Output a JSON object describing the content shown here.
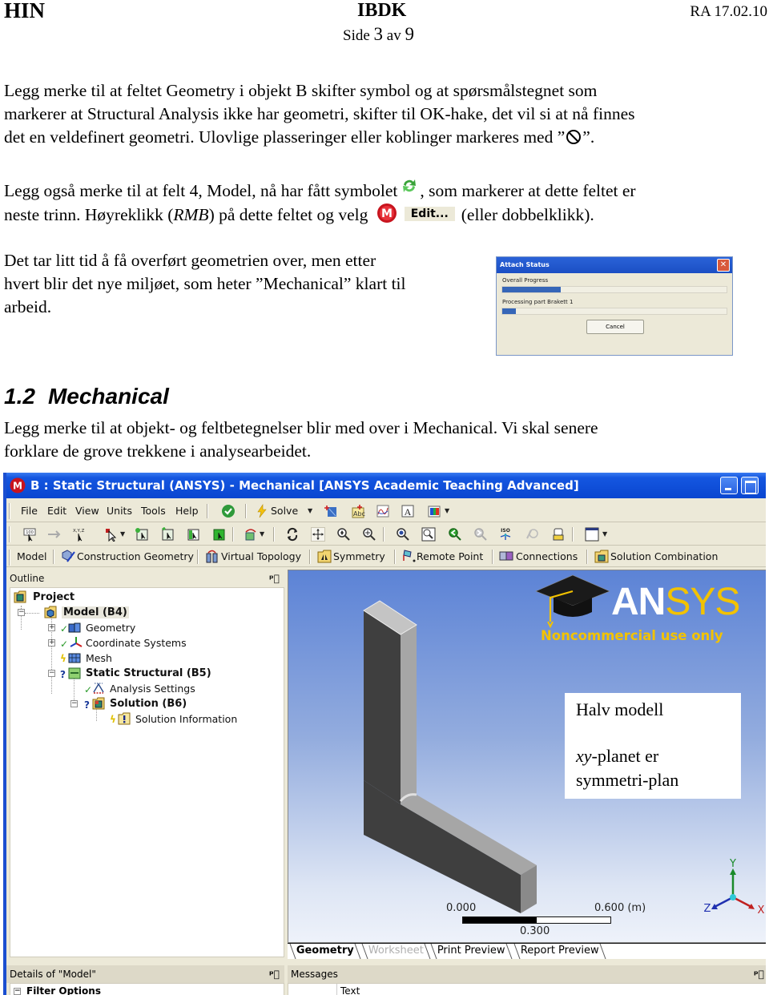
{
  "header": {
    "left": "HIN",
    "center": "IBDK",
    "right": "RA 17.02.10",
    "page_prefix": "Side",
    "page_num": "3",
    "page_sep": "av",
    "page_total": "9"
  },
  "paragraphs": {
    "p1": {
      "line1": "Legg merke til at feltet Geometry i objekt B skifter symbol og at spørsmålstegnet som",
      "line2": "markerer at Structural Analysis ikke har geometri, skifter til OK-hake, det vil si at nå finnes",
      "line3_pre": "det en veldefinert geometri. Ulovlige plasseringer eller koblinger markeres med ”",
      "line3_icon": "prohibited-icon",
      "line3_post": "”."
    },
    "p2": {
      "line1_pre": "Legg også merke til at felt 4, Model, nå har fått symbolet",
      "line1_icon": "refresh-icon",
      "line1_post": ", som markerer at dette feltet er",
      "line2_pre": "neste trinn. Høyreklikk (",
      "line2_italic": "RMB",
      "line2_mid": ") på dette feltet og velg",
      "edit_label": "Edit...",
      "line2_post": "(eller dobbelklikk)."
    },
    "p3": {
      "line1": "Det tar litt tid å få overført geometrien over, men etter",
      "line2": "hvert blir det nye miljøet, som heter ”Mechanical” klart til",
      "line3": "arbeid."
    },
    "section": {
      "number": "1.2",
      "title": "Mechanical"
    },
    "p4": {
      "line1": "Legg merke til at objekt- og feltbetegnelser blir med over i Mechanical. Vi skal senere",
      "line2": "forklare de grove trekkene i analysearbeidet."
    }
  },
  "attach_dialog": {
    "title": "Attach Status",
    "overall_label": "Overall Progress",
    "overall_progress": 0.26,
    "part_label": "Processing part Brakett 1",
    "part_progress": 0.06,
    "cancel_label": "Cancel"
  },
  "window": {
    "title": "B : Static Structural (ANSYS) - Mechanical [ANSYS Academic Teaching Advanced]",
    "menu": [
      "File",
      "Edit",
      "View",
      "Units",
      "Tools",
      "Help"
    ],
    "solve_label": "Solve",
    "context_toolbar": [
      "Model",
      "Construction Geometry",
      "Virtual Topology",
      "Symmetry",
      "Remote Point",
      "Connections",
      "Solution Combination"
    ],
    "outline": {
      "title": "Outline",
      "nodes": [
        {
          "label": "Project",
          "bold": true,
          "status": ""
        },
        {
          "label": "Model (B4)",
          "bold": true,
          "status": ""
        },
        {
          "label": "Geometry",
          "bold": false,
          "status": "ok"
        },
        {
          "label": "Coordinate Systems",
          "bold": false,
          "status": "ok"
        },
        {
          "label": "Mesh",
          "bold": false,
          "status": "lightning"
        },
        {
          "label": "Static Structural (B5)",
          "bold": true,
          "status": "question"
        },
        {
          "label": "Analysis Settings",
          "bold": false,
          "status": "ok"
        },
        {
          "label": "Solution (B6)",
          "bold": true,
          "status": "question"
        },
        {
          "label": "Solution Information",
          "bold": false,
          "status": "lightning"
        }
      ]
    },
    "viewport": {
      "logo_word_white": "AN",
      "logo_word_yellow": "SYS",
      "noncommercial": "Noncommercial use only",
      "note_line1": "Halv modell",
      "note_line2_italic": "xy",
      "note_line2_rest": "-planet er",
      "note_line3": "symmetri-plan",
      "scale_start": "0.000",
      "scale_mid": "0.300",
      "scale_end": "0.600 (m)",
      "axes": [
        "Y",
        "X",
        "Z"
      ]
    },
    "tabs": [
      {
        "label": "Geometry",
        "state": "active"
      },
      {
        "label": "Worksheet",
        "state": "disabled"
      },
      {
        "label": "Print Preview",
        "state": "normal"
      },
      {
        "label": "Report Preview",
        "state": "normal"
      }
    ],
    "details": {
      "title": "Details of \"Model\"",
      "first_group": "Filter Options"
    },
    "messages": {
      "title": "Messages",
      "column": "Text"
    }
  },
  "colors": {
    "xp_title_blue": "#0a46d0",
    "ansys_yellow": "#f2c200",
    "progress_blue": "#3666b8",
    "ok_green": "#2a9a2a"
  }
}
